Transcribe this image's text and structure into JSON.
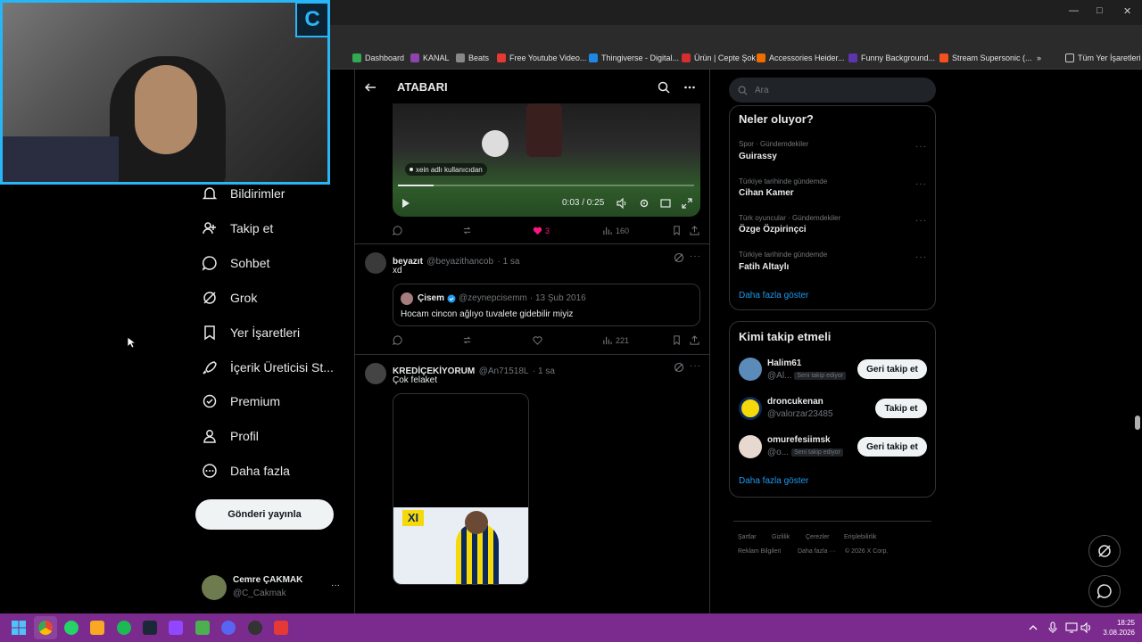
{
  "browser": {
    "window_controls": [
      "—",
      "□",
      "✕"
    ],
    "bookmarks": [
      {
        "label": "Dashboard",
        "color": "#34a853"
      },
      {
        "label": "KANAL",
        "color": "#8e44ad"
      },
      {
        "label": "Beats",
        "color": "#888888"
      },
      {
        "label": "Free Youtube Video...",
        "color": "#e53935"
      },
      {
        "label": "Thingiverse - Digital...",
        "color": "#1e88e5"
      },
      {
        "label": "Ürün | Cepte Şok",
        "color": "#d32f2f"
      },
      {
        "label": "Accessories Heider...",
        "color": "#ef6c00"
      },
      {
        "label": "Funny Background...",
        "color": "#5e35b1"
      },
      {
        "label": "Stream Supersonic (...",
        "color": "#f4511e"
      }
    ],
    "bookmarks_more": "»",
    "all_bookmarks": "Tüm Yer İşaretleri"
  },
  "webcam": {
    "logo": "C"
  },
  "nav": {
    "items": [
      {
        "label": "Bildirimler",
        "icon": "bell-icon"
      },
      {
        "label": "Takip et",
        "icon": "person-plus-icon"
      },
      {
        "label": "Sohbet",
        "icon": "chat-icon"
      },
      {
        "label": "Grok",
        "icon": "grok-icon"
      },
      {
        "label": "Yer İşaretleri",
        "icon": "bookmark-icon"
      },
      {
        "label": "İçerik Üreticisi St...",
        "icon": "rocket-icon"
      },
      {
        "label": "Premium",
        "icon": "verified-icon"
      },
      {
        "label": "Profil",
        "icon": "person-icon"
      },
      {
        "label": "Daha fazla",
        "icon": "more-circle-icon"
      }
    ],
    "post_button": "Gönderi yayınla",
    "profile": {
      "name": "Cemre ÇAKMAK",
      "handle": "@C_Cakmak",
      "more": "···"
    }
  },
  "center": {
    "title": "ATABARI",
    "video": {
      "source_label": "xein adlı kullanıcıdan",
      "time": "0:03 / 0:25",
      "progress": 0.12
    },
    "tweet0_actions": {
      "likes": "3",
      "views": "160"
    },
    "tweet1": {
      "name": "beyazıt",
      "handle": "@beyazithancob",
      "time": "· 1 sa",
      "text": "xd",
      "quote": {
        "name": "Çisem",
        "handle": "@zeynepcisemm",
        "time": "· 13 Şub 2016",
        "text": "Hocam cincon ağlıyo tuvalete gidebilir miyiz"
      },
      "views": "221"
    },
    "tweet2": {
      "name": "KREDİÇEKİYORUM",
      "handle": "@An71518L",
      "time": "· 1 sa",
      "text": "Çok felaket",
      "image_badge": "XI"
    }
  },
  "right": {
    "search_placeholder": "Ara",
    "trends_title": "Neler oluyor?",
    "trends": [
      {
        "sub": "Spor · Gündemdekiler",
        "name": "Guirassy"
      },
      {
        "sub": "Türkiye tarihinde gündemde",
        "name": "Cihan Kamer"
      },
      {
        "sub": "Türk oyuncular · Gündemdekiler",
        "name": "Özge Özpirinçci"
      },
      {
        "sub": "Türkiye tarihinde gündemde",
        "name": "Fatih Altaylı"
      }
    ],
    "trends_more": "Daha fazla göster",
    "who_title": "Kimi takip etmeli",
    "who": [
      {
        "name": "Halim61",
        "handle": "@Al...",
        "badge": "Seni takip ediyor",
        "button": "Geri takip et"
      },
      {
        "name": "droncukenan",
        "handle": "@valorzar23485",
        "badge": "",
        "button": "Takip et"
      },
      {
        "name": "omurefesiimsk",
        "handle": "@o...",
        "badge": "Seni takip ediyor",
        "button": "Geri takip et"
      }
    ],
    "who_more": "Daha fazla göster",
    "footer": [
      "Şartlar",
      "Gizlilik",
      "Çerezler",
      "Erişilebilirlik",
      "Reklam Bilgileri",
      "Daha fazla ···",
      "© 2026 X Corp."
    ]
  },
  "taskbar": {
    "time": "18:25",
    "date": "3.08.2026"
  },
  "colors": {
    "accent": "#1d9bf0",
    "like": "#f91880",
    "taskbar": "#7b2a8e",
    "webcam_border": "#29b6f6"
  }
}
